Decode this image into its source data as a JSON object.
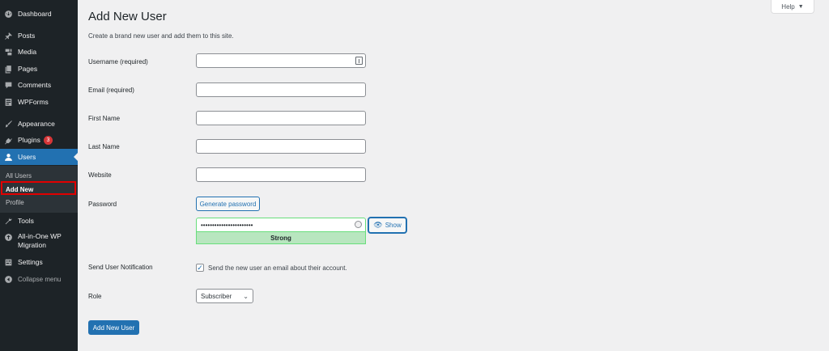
{
  "sidebar": {
    "items": [
      {
        "label": "Dashboard",
        "icon": "dashboard-icon"
      },
      {
        "label": "Posts",
        "icon": "pin-icon"
      },
      {
        "label": "Media",
        "icon": "media-icon"
      },
      {
        "label": "Pages",
        "icon": "pages-icon"
      },
      {
        "label": "Comments",
        "icon": "comment-icon"
      },
      {
        "label": "WPForms",
        "icon": "forms-icon"
      },
      {
        "label": "Appearance",
        "icon": "brush-icon"
      },
      {
        "label": "Plugins",
        "icon": "plugin-icon",
        "badge": "3"
      },
      {
        "label": "Users",
        "icon": "user-icon"
      },
      {
        "label": "Tools",
        "icon": "wrench-icon"
      },
      {
        "label": "All-in-One WP Migration",
        "icon": "migration-icon"
      },
      {
        "label": "Settings",
        "icon": "settings-icon"
      },
      {
        "label": "Collapse menu",
        "icon": "collapse-icon"
      }
    ],
    "submenu": [
      {
        "label": "All Users"
      },
      {
        "label": "Add New"
      },
      {
        "label": "Profile"
      }
    ]
  },
  "header": {
    "title": "Add New User",
    "help_label": "Help",
    "description": "Create a brand new user and add them to this site."
  },
  "form": {
    "username_label": "Username (required)",
    "username_value": "",
    "email_label": "Email (required)",
    "email_value": "",
    "first_name_label": "First Name",
    "first_name_value": "",
    "last_name_label": "Last Name",
    "last_name_value": "",
    "website_label": "Website",
    "website_value": "",
    "password_label": "Password",
    "generate_password_label": "Generate password",
    "password_value": "•••••••••••••••••••••••",
    "show_label": "Show",
    "strength_label": "Strong",
    "notification_label": "Send User Notification",
    "notification_text": "Send the new user an email about their account.",
    "notification_checked": true,
    "role_label": "Role",
    "role_value": "Subscriber",
    "submit_label": "Add New User"
  },
  "colors": {
    "accent": "#2271b1",
    "sidebar_bg": "#1d2327",
    "badge": "#d63638",
    "strength_bg": "#b8e6bf",
    "highlight": "#e10000"
  }
}
